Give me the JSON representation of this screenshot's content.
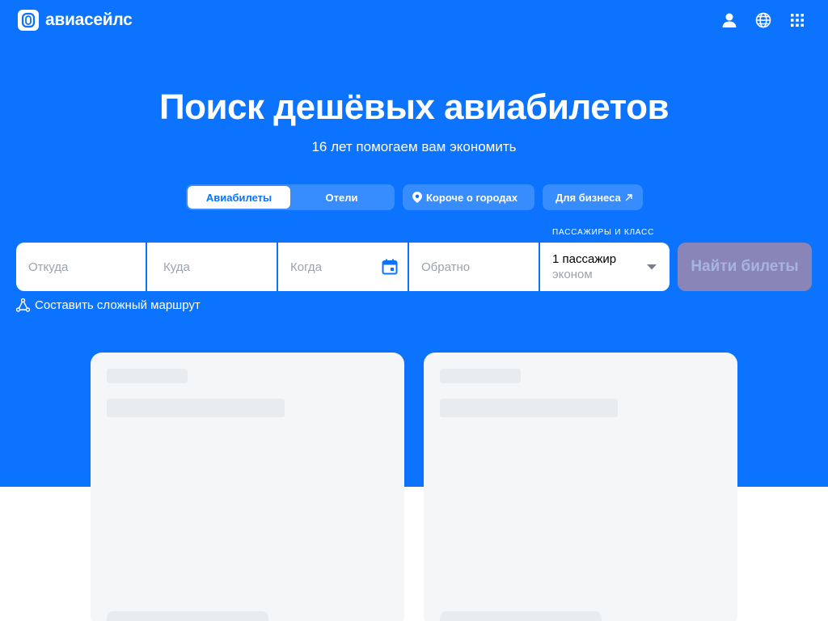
{
  "header": {
    "logo_text": "авиасейлс",
    "icons": [
      "profile-icon",
      "globe-icon",
      "apps-grid-icon"
    ]
  },
  "hero": {
    "title": "Поиск дешёвых авиабилетов",
    "subtitle": "16 лет помогаем вам экономить"
  },
  "tabs": {
    "flights": "Авиабилеты",
    "hotels": "Отели",
    "cities": "Короче о городах",
    "business": "Для бизнеса"
  },
  "search": {
    "from_placeholder": "Откуда",
    "to_placeholder": "Куда",
    "date_placeholder": "Когда",
    "return_placeholder": "Обратно",
    "passengers_caption": "ПАССАЖИРЫ И КЛАСС",
    "passengers_value": "1 пассажир",
    "class_value": "эконом",
    "submit_label": "Найти билеты"
  },
  "complex_route_label": "Составить сложный маршрут",
  "colors": {
    "brand_blue": "#0c73fe",
    "disabled_button": "#8a85b8"
  }
}
